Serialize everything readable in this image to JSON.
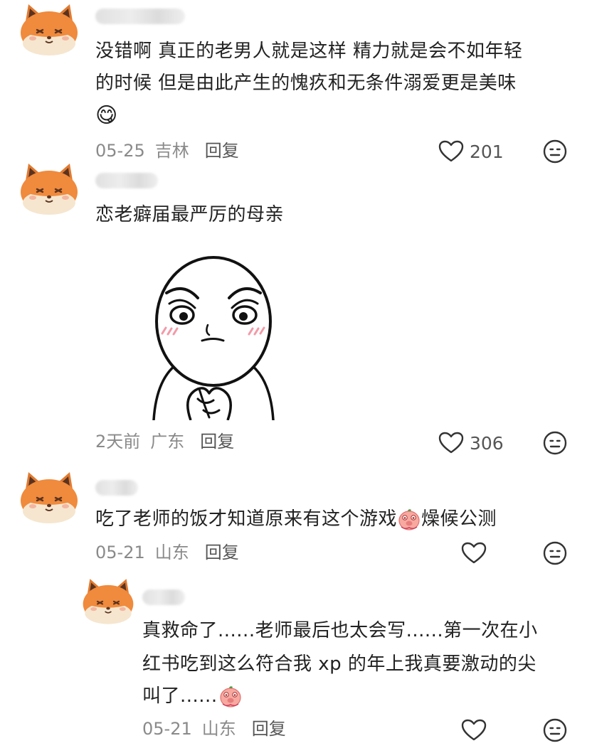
{
  "comments": [
    {
      "text_line1": "没错啊 真正的老男人就是这样 精力就是会不如年轻",
      "text_line2": "的时候 但是由此产生的愧疚和无条件溺爱更是美味",
      "emoji": "😋",
      "date": "05-25",
      "location": "吉林",
      "reply": "回复",
      "likes": "201"
    },
    {
      "text": "恋老癖届最严厉的母亲",
      "date": "2天前",
      "location": "广东",
      "reply": "回复",
      "likes": "306"
    },
    {
      "text": "吃了老师的饭才知道原来有这个游戏",
      "text_after": "燥候公测",
      "date": "05-21",
      "location": "山东",
      "reply": "回复"
    }
  ],
  "reply": {
    "text_line1": "真救命了......老师最后也太会写......第一次在小",
    "text_line2": "红书吃到这么符合我 xp 的年上我真要激动的尖",
    "text_line3": "叫了......",
    "date": "05-21",
    "location": "山东",
    "reply": "回复"
  },
  "colors": {
    "meta": "#8a8a8a",
    "fox": "#f08a3c",
    "blush": "#f7a6b4"
  },
  "icons": [
    "fox-avatar-icon",
    "heart-icon",
    "neutral-face-icon",
    "pig-emoji-icon"
  ]
}
